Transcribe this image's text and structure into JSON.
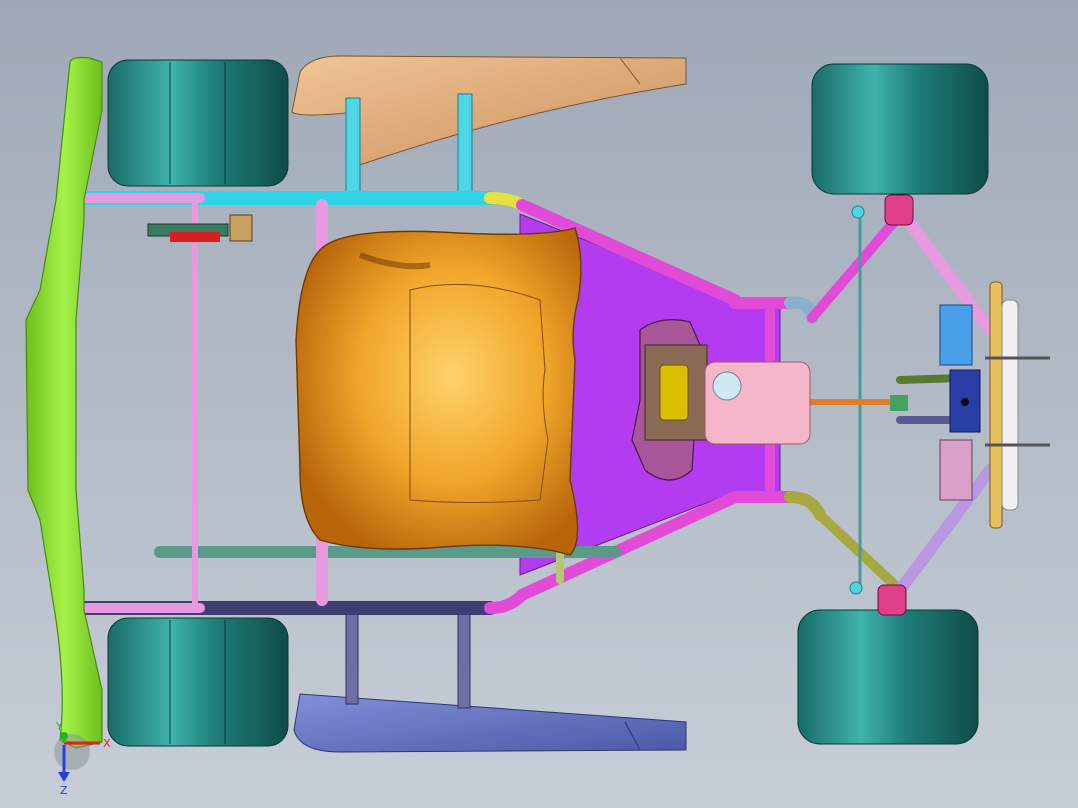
{
  "viewport": {
    "background_top": "#9fa8b6",
    "background_bottom": "#c7ced8"
  },
  "model": {
    "colors": {
      "tire": "#1f7d77",
      "tire_highlight": "#5fc6bd",
      "seat": "#e8930f",
      "seat_highlight": "#ffd36a",
      "floor_pan": "#b43cf0",
      "frame_magenta": "#e24ad8",
      "frame_cyan": "#2fd4e8",
      "bumper_green": "#8ee22a",
      "sidepod_tan": "#e2b07f",
      "sidepod_blue": "#6a78c8",
      "tank_pink": "#f4b6c8"
    }
  },
  "triad": {
    "x_label": "X",
    "y_label": "Y",
    "z_label": "Z",
    "x_color": "#e81c1c",
    "y_color": "#22b222",
    "z_color": "#2a3ee0"
  }
}
